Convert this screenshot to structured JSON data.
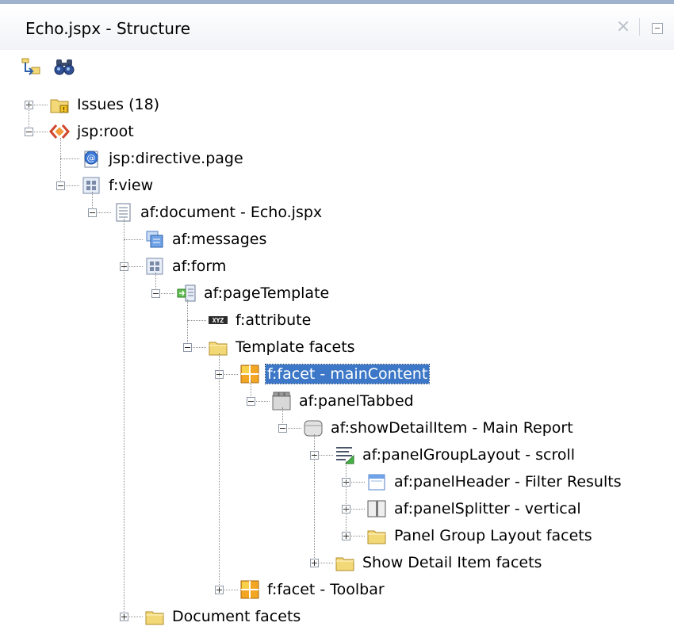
{
  "panel": {
    "title": "Echo.jspx - Structure",
    "close_glyph": "×"
  },
  "toolbar": {
    "buttons": [
      "synchronize-icon",
      "find-binoculars-icon"
    ]
  },
  "colors": {
    "selection": "#3c78c7",
    "folder": "#f3d878",
    "tree_lines": "#8a8a8a"
  },
  "tree": {
    "items": [
      {
        "label": "Issues (18)",
        "icon": "issues-folder-icon",
        "expander": "plus"
      },
      {
        "label": "jsp:root",
        "icon": "jsp-root-icon",
        "expander": "minus"
      },
      {
        "label": "jsp:directive.page",
        "icon": "directive-icon",
        "expander": "none"
      },
      {
        "label": "f:view",
        "icon": "view-icon",
        "expander": "minus"
      },
      {
        "label": "af:document - Echo.jspx",
        "icon": "document-icon",
        "expander": "minus"
      },
      {
        "label": "af:messages",
        "icon": "messages-icon",
        "expander": "none"
      },
      {
        "label": "af:form",
        "icon": "form-icon",
        "expander": "minus"
      },
      {
        "label": "af:pageTemplate",
        "icon": "page-template-icon",
        "expander": "minus"
      },
      {
        "label": "f:attribute",
        "icon": "attribute-icon",
        "expander": "none"
      },
      {
        "label": "Template facets",
        "icon": "folder-icon",
        "expander": "minus"
      },
      {
        "label": "f:facet - mainContent",
        "icon": "facet-icon",
        "expander": "minus",
        "selected": true
      },
      {
        "label": "af:panelTabbed",
        "icon": "panel-tabbed-icon",
        "expander": "minus"
      },
      {
        "label": "af:showDetailItem - Main Report",
        "icon": "show-detail-item-icon",
        "expander": "minus"
      },
      {
        "label": "af:panelGroupLayout - scroll",
        "icon": "panel-group-layout-icon",
        "expander": "minus"
      },
      {
        "label": "af:panelHeader - Filter Results",
        "icon": "panel-header-icon",
        "expander": "plus"
      },
      {
        "label": "af:panelSplitter - vertical",
        "icon": "panel-splitter-icon",
        "expander": "plus"
      },
      {
        "label": "Panel Group Layout facets",
        "icon": "folder-icon",
        "expander": "plus"
      },
      {
        "label": "Show Detail Item facets",
        "icon": "folder-icon",
        "expander": "plus"
      },
      {
        "label": "f:facet - Toolbar",
        "icon": "facet-icon",
        "expander": "plus"
      },
      {
        "label": "Document facets",
        "icon": "folder-icon",
        "expander": "plus"
      }
    ]
  }
}
